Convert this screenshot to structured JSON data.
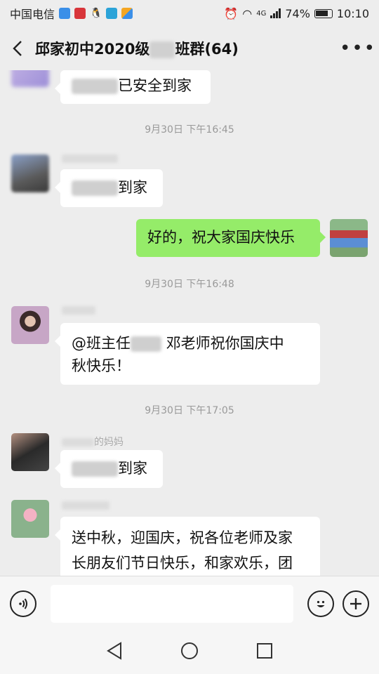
{
  "status": {
    "carrier": "中国电信",
    "network": "4G",
    "battery": "74%",
    "time": "10:10"
  },
  "header": {
    "title_prefix": "邱家初中2020级",
    "title_suffix": "班群(64)",
    "more_label": "•••"
  },
  "messages": [
    {
      "text": "已安全到家"
    },
    {
      "time": "9月30日 下午16:45"
    },
    {
      "text": "到家"
    },
    {
      "text": "好的，祝大家国庆快乐"
    },
    {
      "time": "9月30日 下午16:48"
    },
    {
      "text_a": "@班主任",
      "text_b": "邓老师祝你国庆中",
      "text_c": "秋快乐！"
    },
    {
      "time": "9月30日 下午17:05"
    },
    {
      "nick": "的妈妈",
      "text": "到家"
    },
    {
      "text_a": "送中秋，迎国庆，祝各位老师及家",
      "text_b": "长朋友们节日快乐，和家欢乐，团"
    }
  ],
  "colors": {
    "background": "#ededed",
    "my_bubble": "#95ec69",
    "other_bubble": "#ffffff"
  }
}
